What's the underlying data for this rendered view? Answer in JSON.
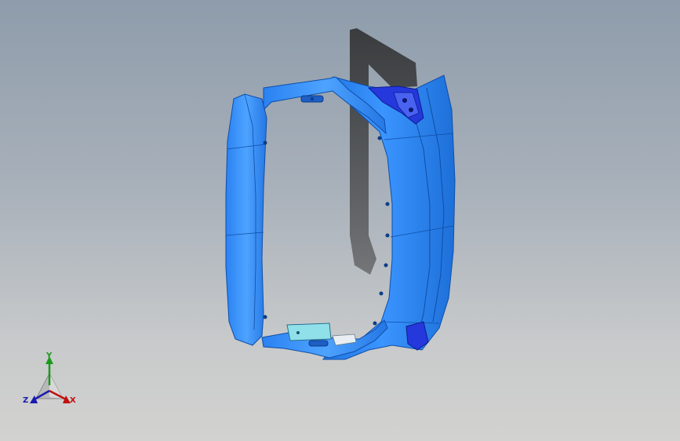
{
  "viewport": {
    "background_top": "#8e9cab",
    "background_bottom": "#d2d2d0"
  },
  "model": {
    "part_color": "#2e86f0",
    "part_highlight": "#5aa8ff",
    "part_shadow_color": "#232323",
    "bracket_color": "#1f2fd8"
  },
  "triad": {
    "x_label": "X",
    "y_label": "Y",
    "z_label": "Z",
    "x_color": "#c01010",
    "y_color": "#1a9a1a",
    "z_color": "#1a1ab0",
    "x_icon": "x-axis-arrow-icon",
    "y_icon": "y-axis-arrow-icon",
    "z_icon": "z-axis-arrow-icon"
  }
}
